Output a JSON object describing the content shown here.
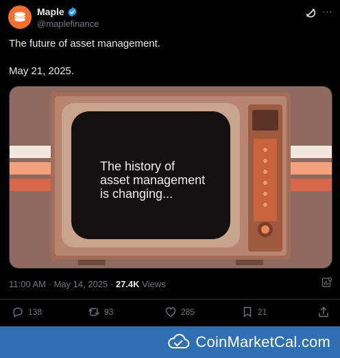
{
  "tweet": {
    "author_name": "Maple",
    "handle": "@maplefinance",
    "line1": "The future of asset management.",
    "line2": "May 21, 2025.",
    "media_text": [
      "The history of",
      "asset management",
      "is changing..."
    ],
    "time": "11:00 AM · May 14, 2025 · ",
    "views_count": "27.4K",
    "views_label": " Views"
  },
  "actions": {
    "replies": "138",
    "reposts": "93",
    "likes": "285",
    "bookmarks": "21"
  },
  "banner": {
    "label": "CoinMarketCal.com"
  },
  "colors": {
    "background": "#000000",
    "brand_orange": "#f4702a",
    "verified_blue": "#1d9bf0",
    "banner_blue": "#2f6fb4",
    "muted": "#71767b"
  },
  "icons": [
    "maple-logo-icon",
    "verified-badge-icon",
    "grok-icon",
    "more-icon",
    "analytics-icon",
    "reply-icon",
    "repost-icon",
    "like-icon",
    "bookmark-icon",
    "share-icon",
    "coinmarketcal-logo-icon"
  ]
}
